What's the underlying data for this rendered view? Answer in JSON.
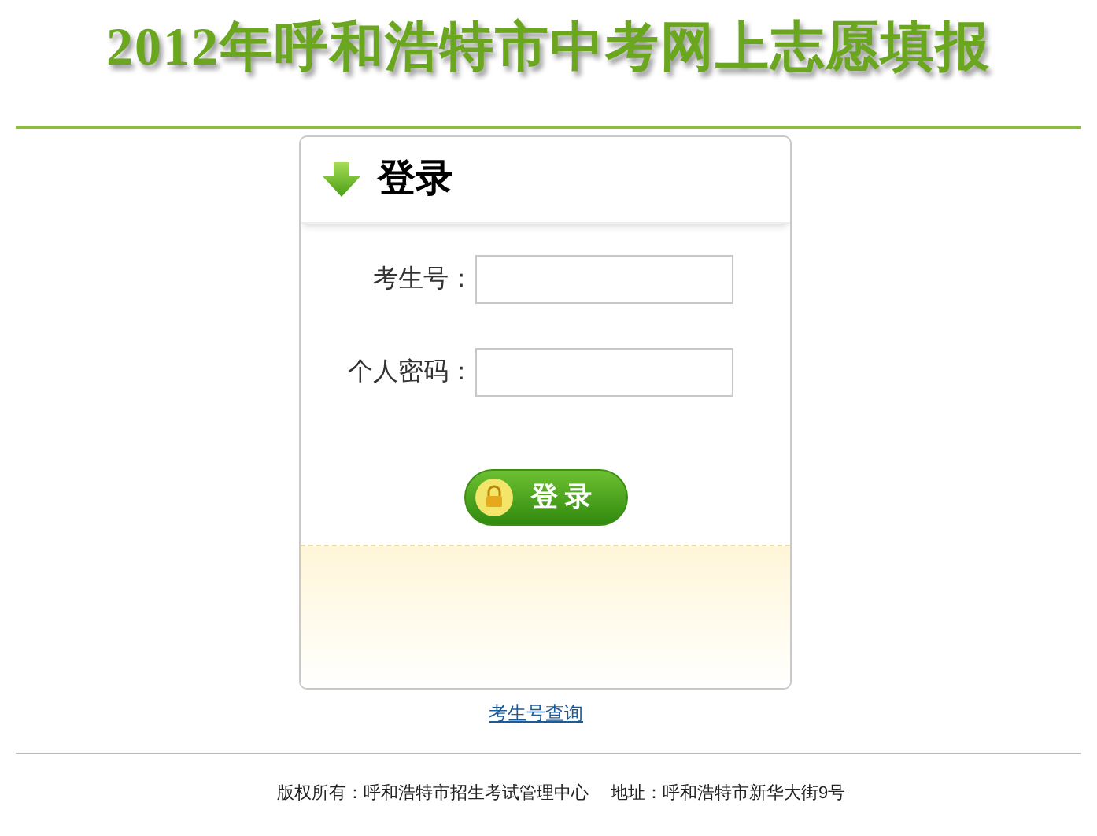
{
  "header": {
    "title": "2012年呼和浩特市中考网上志愿填报"
  },
  "login_panel": {
    "title": "登录",
    "fields": [
      {
        "label": "考生号："
      },
      {
        "label": "个人密码："
      }
    ],
    "submit_button": "登 录"
  },
  "lookup_link": "考生号查询",
  "footer": {
    "copyright": "版权所有：呼和浩特市招生考试管理中心",
    "address": "地址：呼和浩特市新华大街9号"
  }
}
